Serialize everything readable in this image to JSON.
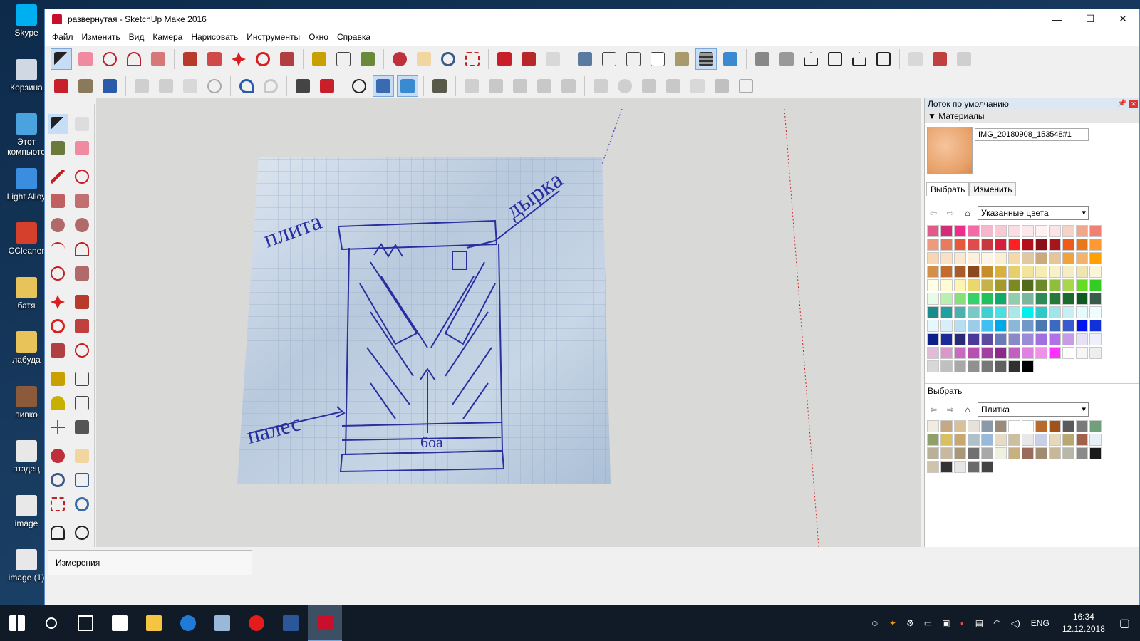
{
  "desktop": {
    "icons": [
      {
        "label": "Skype",
        "color": "#00aff0"
      },
      {
        "label": "Корзина",
        "color": "#cfd8e3"
      },
      {
        "label": "Этот компьюте",
        "color": "#4aa3df"
      },
      {
        "label": "Light Alloy",
        "color": "#3b8de0"
      },
      {
        "label": "CCleaner",
        "color": "#d4402b"
      },
      {
        "label": "батя",
        "color": "#e8c35a"
      },
      {
        "label": "лабуда",
        "color": "#e8c35a"
      },
      {
        "label": "пивко",
        "color": "#8a5a3a"
      },
      {
        "label": "птздец",
        "color": "#e8e8e8"
      },
      {
        "label": "image",
        "color": "#e8e8e8"
      },
      {
        "label": "image (1)",
        "color": "#e8e8e8"
      }
    ]
  },
  "window": {
    "title": "развернутая - SketchUp Make 2016",
    "controls": {
      "minimize": "—",
      "maximize": "☐",
      "close": "✕"
    }
  },
  "menu": [
    "Файл",
    "Изменить",
    "Вид",
    "Камера",
    "Нарисовать",
    "Инструменты",
    "Окно",
    "Справка"
  ],
  "canvas": {
    "labels": {
      "top_left": "плита",
      "top_right": "дырка",
      "bottom_left": "палес",
      "bottom_mark": "6оа"
    }
  },
  "status": {
    "measurements_label": "Измерения"
  },
  "tray": {
    "title": "Лоток по умолчанию",
    "materials_section": "Материалы",
    "material_name": "IMG_20180908_153548#1",
    "tab_select": "Выбрать",
    "tab_edit": "Изменить",
    "color_collection": "Указанные цвета",
    "lower_label": "Выбрать",
    "lower_collection": "Плитка",
    "colors": [
      "#e05a8a",
      "#d42c77",
      "#ee2c8c",
      "#f56aa6",
      "#f7b6cc",
      "#f9c9d4",
      "#fadce2",
      "#fde7ea",
      "#fff1f2",
      "#fce4e4",
      "#f6d3c7",
      "#f2a68a",
      "#f08070",
      "#ee9a7f",
      "#ea7a5e",
      "#e8583a",
      "#e04b4b",
      "#c7373d",
      "#d81e3a",
      "#ff2020",
      "#b40f1a",
      "#8e0e18",
      "#a6151b",
      "#f05a1a",
      "#e8781a",
      "#ff9933",
      "#f7d6b1",
      "#fbe1c4",
      "#f9e8d2",
      "#fdf0dd",
      "#fff5e6",
      "#fceed3",
      "#f5d9a8",
      "#e2c7a3",
      "#caa97a",
      "#e8c598",
      "#f2a23b",
      "#f5b26b",
      "#ff9f00",
      "#d2904b",
      "#c46a2a",
      "#a95c2a",
      "#8b4a1e",
      "#c68d2b",
      "#d8b13a",
      "#e8cf6c",
      "#f3e49b",
      "#f7ecb3",
      "#f9f1c7",
      "#f5eec0",
      "#eee6b0",
      "#fbf6d8",
      "#fffde6",
      "#fffbd2",
      "#fff4b0",
      "#e9d96a",
      "#c4b24a",
      "#a39a2a",
      "#7c8a1f",
      "#556b1c",
      "#6d8a2a",
      "#8fbf3a",
      "#a8d84a",
      "#66dd22",
      "#33cc22",
      "#e8fbe8",
      "#b8f0b0",
      "#86e07a",
      "#36d16a",
      "#22c05a",
      "#11aa6a",
      "#8fcfb0",
      "#7ab6a0",
      "#2e8b57",
      "#257a3a",
      "#1a6a2a",
      "#0f5a20",
      "#3a5a4a",
      "#1a8a8a",
      "#20a0a0",
      "#4ab0b0",
      "#7ac8c8",
      "#40d0d0",
      "#48e0e0",
      "#a8e8e8",
      "#00f0f0",
      "#30c8c8",
      "#9ee6ec",
      "#c6f0f4",
      "#e4fafc",
      "#f0fdff",
      "#e8f6fd",
      "#d8eef9",
      "#b8dff0",
      "#9ccde8",
      "#40bff0",
      "#00a8e8",
      "#8ab8d8",
      "#7098c8",
      "#4a78b0",
      "#3c6ac0",
      "#3a5ad0",
      "#0014f0",
      "#1030d8",
      "#0a1f8a",
      "#1a2a9a",
      "#2a2a7a",
      "#4a3a9a",
      "#5a4aa0",
      "#6a7ab8",
      "#8a8ac8",
      "#9a8ad8",
      "#a070e0",
      "#b070e8",
      "#c89ae8",
      "#e8e0f6",
      "#f0f0fa",
      "#e0bcd8",
      "#d898c8",
      "#c86ac0",
      "#b850b0",
      "#a040a0",
      "#8a2a8a",
      "#c060c0",
      "#e080e0",
      "#f090e8",
      "#ff30ff",
      "#ffffff",
      "#f6f6f6",
      "#eeeeee",
      "#d8d8d8",
      "#c0c0c0",
      "#a8a8a8",
      "#909090",
      "#787878",
      "#606060",
      "#303030",
      "#000000"
    ],
    "textures": [
      "#f0ece0",
      "#c8a880",
      "#d8c098",
      "#e6e2da",
      "#8a9aa8",
      "#9a8a7a",
      "#ffffff",
      "#ffffff",
      "#b86a2a",
      "#a0521c",
      "#5a5a5a",
      "#7a7a7a",
      "#6fa07a",
      "#8fa06a",
      "#d8c060",
      "#c8a870",
      "#b0c0c8",
      "#9ab8d8",
      "#e6dcc6",
      "#cbbfa0",
      "#e8e8e8",
      "#c8d0e6",
      "#e6d8b8",
      "#b8a870",
      "#a0604a",
      "#e6f0f6",
      "#b8b098",
      "#c8b8a0",
      "#a89878",
      "#707070",
      "#a8a8a8",
      "#eef0e0",
      "#c8b080",
      "#9a6a5a",
      "#a08a70",
      "#c8b89a",
      "#b8b8a8",
      "#8a8a8a",
      "#1a1a1a",
      "#cfc3aa",
      "#333333",
      "#e6e6e6",
      "#6a6a6a",
      "#444444"
    ]
  },
  "taskbar": {
    "clock_time": "16:34",
    "clock_date": "12.12.2018",
    "lang": "ENG"
  }
}
